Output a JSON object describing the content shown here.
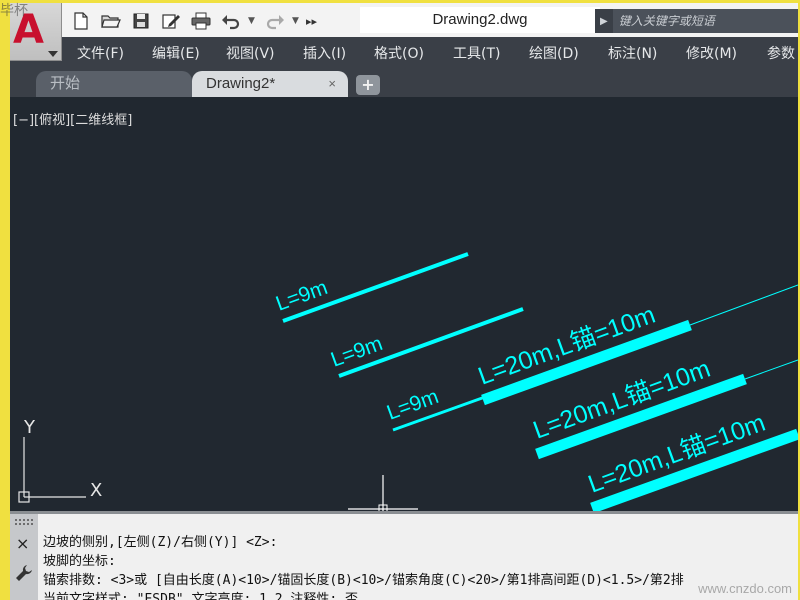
{
  "titlebar": {
    "doc_title": "Drawing2.dwg",
    "search_placeholder": "键入关键字或短语",
    "app_logo_letter": "A",
    "corner_watermark": "毕杯"
  },
  "qat": [
    {
      "name": "new-icon"
    },
    {
      "name": "open-icon"
    },
    {
      "name": "save-icon"
    },
    {
      "name": "save-as-icon"
    },
    {
      "name": "plot-icon"
    },
    {
      "name": "undo-icon"
    },
    {
      "name": "redo-icon"
    }
  ],
  "menu": [
    "文件(F)",
    "编辑(E)",
    "视图(V)",
    "插入(I)",
    "格式(O)",
    "工具(T)",
    "绘图(D)",
    "标注(N)",
    "修改(M)",
    "参数"
  ],
  "tabs": {
    "start": "开始",
    "drawing": "Drawing2*",
    "close_glyph": "×",
    "new_glyph": "+"
  },
  "viewport": {
    "label": "[−][俯视][二维线框]"
  },
  "drawing_labels": [
    "L=9m",
    "L=9m",
    "L=9m",
    "L=20m,L锚=10m",
    "L=20m,L锚=10m",
    "L=20m,L锚=10m"
  ],
  "ucs": {
    "y_label": "Y",
    "x_label": "X"
  },
  "command": {
    "close_glyph": "×",
    "lines": [
      "边坡的侧别,[左侧(Z)/右侧(Y)] <Z>:",
      "坡脚的坐标:",
      "锚索排数: <3>或 [自由长度(A)<10>/锚固长度(B)<10>/锚索角度(C)<20>/第1排高间距(D)<1.5>/第2排",
      "当前文字样式: \"ESDB\"  文字高度:  1.2  注释性:  否"
    ]
  },
  "watermark": "www.cnzdo.com",
  "colors": {
    "accent_cyan": "#00ffff",
    "canvas_bg": "#212830",
    "chrome_dark": "#3a3f47",
    "logo_red": "#c8102e"
  }
}
